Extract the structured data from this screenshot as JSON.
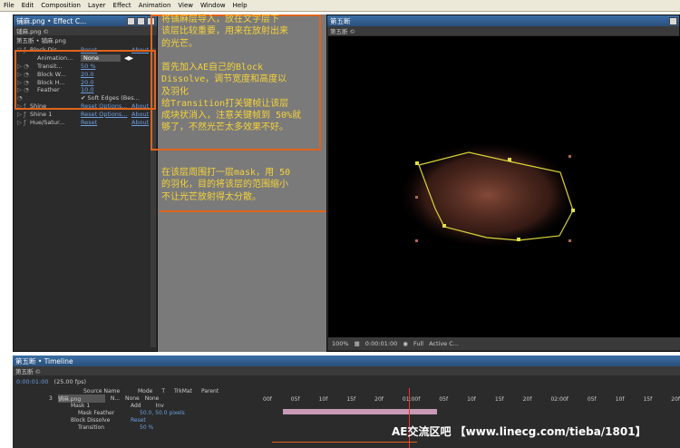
{
  "menu": [
    "File",
    "Edit",
    "Composition",
    "Layer",
    "Effect",
    "Animation",
    "View",
    "Window",
    "Help"
  ],
  "effects_panel": {
    "title": "铺麻.png • Effect C...",
    "tab": "铺麻.png ©",
    "breadcrumb": "第五断 • 铺麻.png",
    "rows": [
      {
        "name": "Block Dis...",
        "reset": "Reset",
        "about": "About"
      },
      {
        "name": "Animation...",
        "value": "None"
      },
      {
        "name": "Transit...",
        "value": "50 %"
      },
      {
        "name": "Block W...",
        "value": "20.0"
      },
      {
        "name": "Block H...",
        "value": "20.0"
      },
      {
        "name": "Feather",
        "value": "10.0"
      },
      {
        "name": "",
        "value": "✔ Soft Edges (Bes..."
      },
      {
        "name": "Shine",
        "reset": "Reset Options...",
        "about": "About"
      },
      {
        "name": "Shine 1",
        "reset": "Reset Options...",
        "about": "About"
      },
      {
        "name": "Hue/Satur...",
        "reset": "Reset",
        "about": "About"
      }
    ]
  },
  "annotations": {
    "top": "将铺麻层导入，放在文字层下\n该层比较重要，用来在放射出来\n的光芒。",
    "middle": "首先加入AE自己的Block\nDissolve，调节宽度和高度以\n及羽化\n给Transition打关键帧让该层\n成块状消入，注意关键帧到 50%就\n够了，不然光芒太多效果不好。",
    "mask": "在该层周围打一层mask，用 50\n的羽化，目的将该层的范围缩小\n不让光芒放射得太分散。"
  },
  "comp_panel": {
    "title": "第五断",
    "tab": "第五断 ©",
    "zoom": "100%",
    "time": "0:00:01:00",
    "resolution": "Full",
    "camera": "Active C..."
  },
  "timeline": {
    "title": "第五断 • Timeline",
    "tab": "第五断 ©",
    "time": "0:00:01:00",
    "fps": "(25.00 fps)",
    "columns": [
      "Source Name",
      "Mode",
      "T",
      "TrkMat",
      "Parent"
    ],
    "layer": {
      "num": "3",
      "name": "铺麻.png",
      "mode": "N...",
      "trkmat": "None",
      "parent": "None"
    },
    "mask": {
      "name": "Mask 1",
      "mode": "Add",
      "inv": "Inv"
    },
    "mask_feather": {
      "name": "Mask Feather",
      "value": "50.0, 50.0 pixels"
    },
    "effect": {
      "name": "Block Dissolve",
      "reset": "Reset"
    },
    "transition": {
      "name": "Transition",
      "value": "50 %"
    },
    "ruler": [
      "00f",
      "05f",
      "10f",
      "15f",
      "20f",
      "01:00f",
      "05f",
      "10f",
      "15f",
      "20f",
      "02:00f",
      "05f",
      "10f",
      "15f",
      "20f"
    ]
  },
  "watermark": "AE交流区吧  【www.linecg.com/tieba/1801】"
}
